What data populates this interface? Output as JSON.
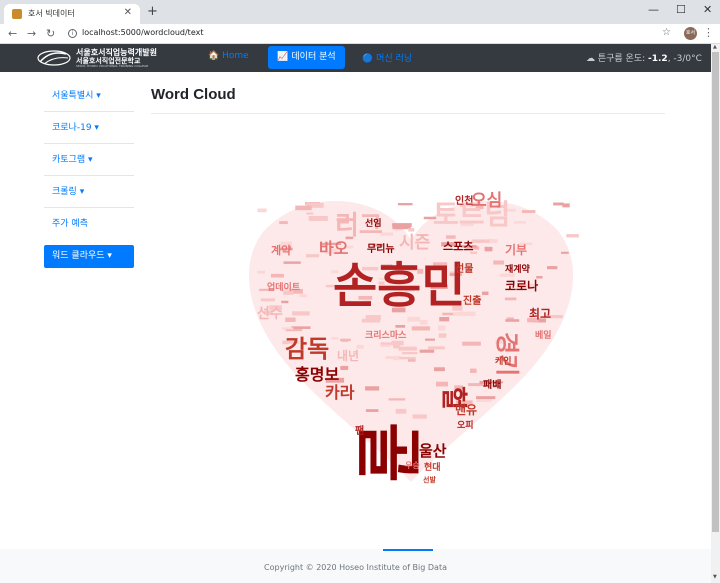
{
  "browser": {
    "tab_title": "호서 빅데이터",
    "tab_close": "✕",
    "new_tab": "+",
    "url": "localhost:5000/wordcloud/text",
    "window_controls": [
      "—",
      "☐",
      "✕"
    ],
    "avatar_text": "호서"
  },
  "navbar": {
    "logo_line1": "서울호서직업능력개발원",
    "logo_line2": "서울호서직업전문학교",
    "logo_line3": "SEOUL HOSEO VOCATIONAL TRAINING COLLEGE",
    "links": [
      {
        "label": "🏠 Home"
      },
      {
        "label": "📈 데이터 분석"
      },
      {
        "label": "🔵 머신 러닝"
      }
    ],
    "weather_prefix": "☁  튼구름 온도: ",
    "weather_temp": "-1.2",
    "weather_suffix": ", -3/0°C"
  },
  "sidebar": {
    "items": [
      {
        "label": "서울특별시 ▾"
      },
      {
        "label": "코로나-19 ▾"
      },
      {
        "label": "카토그램 ▾"
      },
      {
        "label": "크롤링 ▾"
      },
      {
        "label": "주가 예측"
      }
    ],
    "active_label": "워드 클라우드 ▾"
  },
  "main": {
    "title": "Word Cloud"
  },
  "wordcloud": {
    "words": [
      {
        "text": "손흥민",
        "color": "#b22222"
      },
      {
        "text": "골",
        "color": "#8b0000"
      },
      {
        "text": "감독",
        "color": "#c0392b"
      },
      {
        "text": "경기",
        "color": "#e57373"
      },
      {
        "text": "리그",
        "color": "#f4b6b6"
      },
      {
        "text": "토트넘",
        "color": "#f8c8c8"
      },
      {
        "text": "오심",
        "color": "#e57373"
      },
      {
        "text": "현대",
        "color": "#c0392b"
      },
      {
        "text": "홍명보",
        "color": "#8b0000"
      },
      {
        "text": "울산",
        "color": "#8b0000"
      },
      {
        "text": "카라",
        "color": "#c0392b"
      },
      {
        "text": "시즌",
        "color": "#f4b6b6"
      },
      {
        "text": "스포츠",
        "color": "#8b0000"
      },
      {
        "text": "코로나",
        "color": "#8b0000"
      },
      {
        "text": "최고",
        "color": "#b22222"
      },
      {
        "text": "헐",
        "color": "#b22222"
      },
      {
        "text": "선임",
        "color": "#8b0000"
      },
      {
        "text": "인천",
        "color": "#b22222"
      },
      {
        "text": "바오",
        "color": "#e57373"
      },
      {
        "text": "선수",
        "color": "#f4b6b6"
      },
      {
        "text": "크리스마스",
        "color": "#e57373"
      },
      {
        "text": "내년",
        "color": "#f4b6b6"
      },
      {
        "text": "계약",
        "color": "#e57373"
      },
      {
        "text": "재계약",
        "color": "#8b0000"
      },
      {
        "text": "기부",
        "color": "#e57373"
      },
      {
        "text": "맨유",
        "color": "#c0392b"
      },
      {
        "text": "팬",
        "color": "#b22222"
      },
      {
        "text": "업데이트",
        "color": "#e57373"
      },
      {
        "text": "선물",
        "color": "#c0392b"
      },
      {
        "text": "무리뉴",
        "color": "#8b0000"
      },
      {
        "text": "오피",
        "color": "#b22222"
      },
      {
        "text": "베일",
        "color": "#e57373"
      },
      {
        "text": "패배",
        "color": "#8b0000"
      },
      {
        "text": "진출",
        "color": "#c0392b"
      },
      {
        "text": "케인",
        "color": "#c0392b"
      },
      {
        "text": "우승",
        "color": "#e57373"
      },
      {
        "text": "선발",
        "color": "#c0392b"
      }
    ]
  },
  "footer": {
    "text": "Copyright © 2020 Hoseo Institute of Big Data"
  }
}
